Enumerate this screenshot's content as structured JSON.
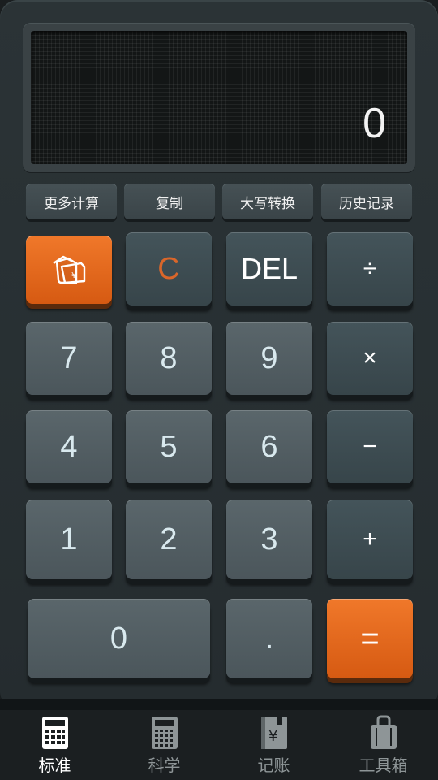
{
  "display": {
    "value": "0"
  },
  "functions": [
    {
      "label": "更多计算"
    },
    {
      "label": "复制"
    },
    {
      "label": "大写转换"
    },
    {
      "label": "历史记录"
    }
  ],
  "keys": {
    "currency_icon": "currency-cards-icon",
    "clear": "C",
    "del": "DEL",
    "divide": "÷",
    "seven": "7",
    "eight": "8",
    "nine": "9",
    "multiply": "×",
    "four": "4",
    "five": "5",
    "six": "6",
    "minus": "−",
    "one": "1",
    "two": "2",
    "three": "3",
    "plus": "+",
    "zero": "0",
    "dot": ".",
    "equals": "="
  },
  "tabs": [
    {
      "label": "标准",
      "icon": "calculator-icon",
      "active": true
    },
    {
      "label": "科学",
      "icon": "scientific-calculator-icon",
      "active": false
    },
    {
      "label": "记账",
      "icon": "ledger-icon",
      "active": false
    },
    {
      "label": "工具箱",
      "icon": "toolbox-icon",
      "active": false
    }
  ],
  "colors": {
    "accent": "#e8691f",
    "clear_text": "#d9662a",
    "key_text": "#d9e9ee"
  }
}
